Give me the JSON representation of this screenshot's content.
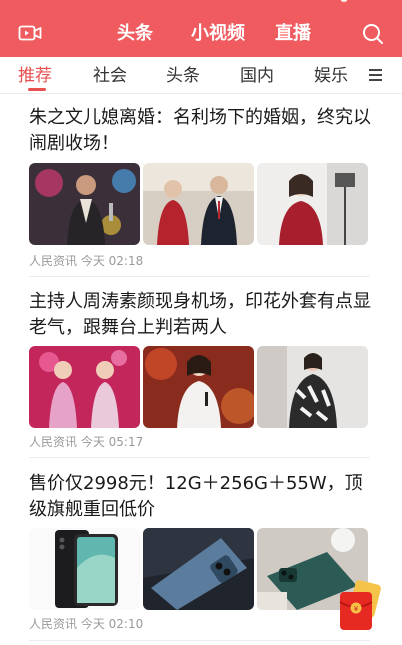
{
  "header": {
    "tabs": [
      "头条",
      "小视频",
      "直播"
    ],
    "icons": {
      "left": "video-camera-icon",
      "right": "search-icon"
    },
    "background": "#ef5b5e"
  },
  "channels": {
    "items": [
      "推荐",
      "社会",
      "头条",
      "国内",
      "娱乐"
    ],
    "active_index": 0,
    "accent": "#e8504f",
    "menu_icon": "hamburger-menu-icon"
  },
  "articles": [
    {
      "title": "朱之文儿媳离婚：名利场下的婚姻，终究以闹剧收场！",
      "source": "人民资讯",
      "time": "今天 02:18"
    },
    {
      "title": "主持人周涛素颜现身机场，印花外套有点显老气，跟舞台上判若两人",
      "source": "人民资讯",
      "time": "今天 05:17"
    },
    {
      "title": "售价仅2998元！12G＋256G＋55W，顶级旗舰重回低价",
      "source": "人民资讯",
      "time": "今天 02:10"
    }
  ],
  "floating": {
    "icon": "red-envelope-icon"
  }
}
